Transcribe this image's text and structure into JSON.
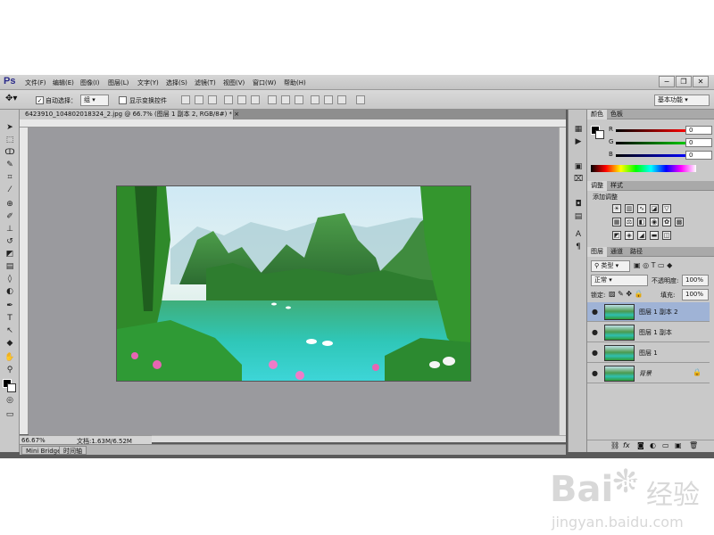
{
  "app": {
    "logo": "Ps",
    "menu": [
      "文件(F)",
      "编辑(E)",
      "图像(I)",
      "图层(L)",
      "文字(Y)",
      "选择(S)",
      "滤镜(T)",
      "视图(V)",
      "窗口(W)",
      "帮助(H)"
    ],
    "window_buttons": [
      "−",
      "❐",
      "✕"
    ]
  },
  "options": {
    "auto_select_label": "自动选择：",
    "auto_select_value": "组",
    "show_transform_label": "显示变换控件",
    "workspace": "基本功能"
  },
  "document": {
    "tab_title": "6423910_104802018324_2.jpg @ 66.7% (图层 1 副本 2, RGB/8#) *",
    "zoom": "66.67%",
    "doc_size": "文档:1.63M/6.52M"
  },
  "bottom_tabs": [
    "Mini Bridge",
    "时间轴"
  ],
  "color_panel": {
    "tabs": [
      "颜色",
      "色板"
    ],
    "channels": [
      {
        "label": "R",
        "value": "0",
        "color": "#d81010"
      },
      {
        "label": "G",
        "value": "0",
        "color": "#10b010"
      },
      {
        "label": "B",
        "value": "0",
        "color": "#1020d0"
      }
    ]
  },
  "adjust_panel": {
    "tabs": [
      "调整",
      "样式"
    ],
    "heading": "添加调整",
    "icons": [
      "brightness-icon",
      "levels-icon",
      "curves-icon",
      "exposure-icon",
      "vibrance-icon",
      "hue-icon",
      "balance-icon",
      "bw-icon",
      "photo-filter-icon",
      "mixer-icon",
      "lookup-icon",
      "invert-icon",
      "posterize-icon",
      "threshold-icon",
      "gradient-map-icon",
      "selective-color-icon"
    ]
  },
  "layers_panel": {
    "tabs": [
      "图层",
      "通道",
      "路径"
    ],
    "filter_label": "类型",
    "blend_mode": "正常",
    "opacity_label": "不透明度:",
    "opacity_value": "100%",
    "lock_label": "锁定:",
    "fill_label": "填充:",
    "fill_value": "100%",
    "layers": [
      {
        "name": "图层 1 副本 2",
        "selected": true
      },
      {
        "name": "图层 1 副本",
        "selected": false
      },
      {
        "name": "图层 1",
        "selected": false
      },
      {
        "name": "背景",
        "selected": false,
        "locked": true
      }
    ],
    "footer_icons": [
      "link-icon",
      "fx-icon",
      "mask-icon",
      "adjust-icon",
      "group-icon",
      "new-layer-icon",
      "trash-icon"
    ]
  },
  "watermark": {
    "brand": "Bai",
    "brand_suffix": "经验",
    "url": "jingyan.baidu.com"
  }
}
